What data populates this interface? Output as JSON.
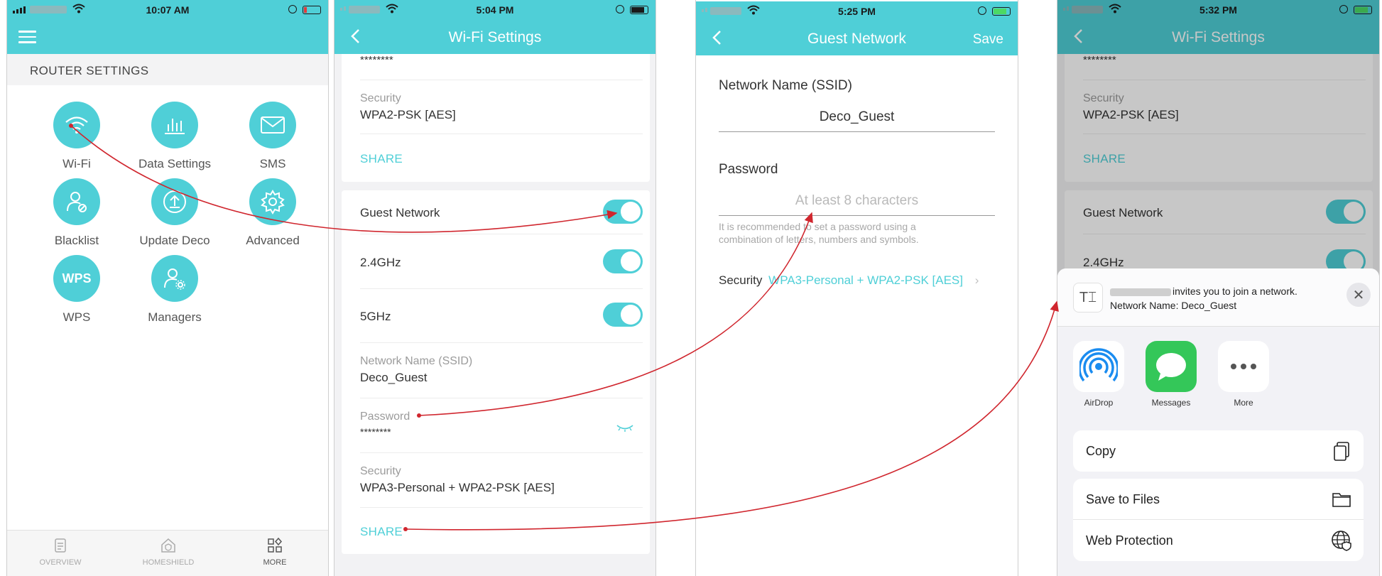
{
  "screens": {
    "router": {
      "status_time": "10:07 AM",
      "section_header": "ROUTER SETTINGS",
      "items": [
        {
          "label": "Wi-Fi",
          "icon": "wifi-icon"
        },
        {
          "label": "Data Settings",
          "icon": "bar-chart-icon"
        },
        {
          "label": "SMS",
          "icon": "envelope-icon"
        },
        {
          "label": "Blacklist",
          "icon": "user-block-icon"
        },
        {
          "label": "Update Deco",
          "icon": "upload-icon"
        },
        {
          "label": "Advanced",
          "icon": "gear-icon"
        },
        {
          "label": "WPS",
          "icon": "wps-icon"
        },
        {
          "label": "Managers",
          "icon": "user-gear-icon"
        }
      ],
      "tabs": [
        {
          "label": "OVERVIEW",
          "icon": "document-icon"
        },
        {
          "label": "HOMESHIELD",
          "icon": "house-shield-icon"
        },
        {
          "label": "MORE",
          "icon": "grid-icon"
        }
      ]
    },
    "wifi_settings": {
      "status_time": "5:04 PM",
      "title": "Wi-Fi Settings",
      "top_masked": "********",
      "security_label": "Security",
      "security_value": "WPA2-PSK [AES]",
      "share_label": "SHARE",
      "guest_network": "Guest Network",
      "band_24": "2.4GHz",
      "band_5": "5GHz",
      "ssid_label": "Network Name (SSID)",
      "ssid_value": "Deco_Guest",
      "password_label": "Password",
      "password_value": "********",
      "guest_security_label": "Security",
      "guest_security_value": "WPA3-Personal + WPA2-PSK [AES]",
      "guest_share_label": "SHARE"
    },
    "guest_network": {
      "status_time": "5:25 PM",
      "title": "Guest Network",
      "save_label": "Save",
      "ssid_label": "Network Name (SSID)",
      "ssid_value": "Deco_Guest",
      "password_label": "Password",
      "password_placeholder": "At least 8 characters",
      "hint_line1": "It is recommended to set a password using a",
      "hint_line2": "combination of letters, numbers and symbols.",
      "security_label": "Security",
      "security_value": "WPA3-Personal + WPA2-PSK [AES]"
    },
    "share_sheet": {
      "status_time": "5:32 PM",
      "title": "Wi-Fi Settings",
      "top_masked": "********",
      "security_label": "Security",
      "security_value": "WPA2-PSK [AES]",
      "share_label": "SHARE",
      "guest_network": "Guest Network",
      "band_24": "2.4GHz",
      "invite_text": "invites you to join a network.",
      "network_name_line": "Network Name: Deco_Guest",
      "doc_glyph": "T⌶",
      "apps": [
        {
          "label": "AirDrop",
          "icon": "airdrop-icon"
        },
        {
          "label": "Messages",
          "icon": "messages-icon"
        },
        {
          "label": "More",
          "icon": "more-dots-icon"
        }
      ],
      "actions": [
        {
          "label": "Copy",
          "icon": "copy-icon"
        },
        {
          "label": "Save to Files",
          "icon": "folder-icon"
        },
        {
          "label": "Web Protection",
          "icon": "globe-shield-icon"
        }
      ]
    }
  },
  "colors": {
    "accent": "#4fcfd7",
    "arrow": "#d0262e",
    "messages_green": "#34c759",
    "airdrop_blue": "#1a8cf0"
  }
}
